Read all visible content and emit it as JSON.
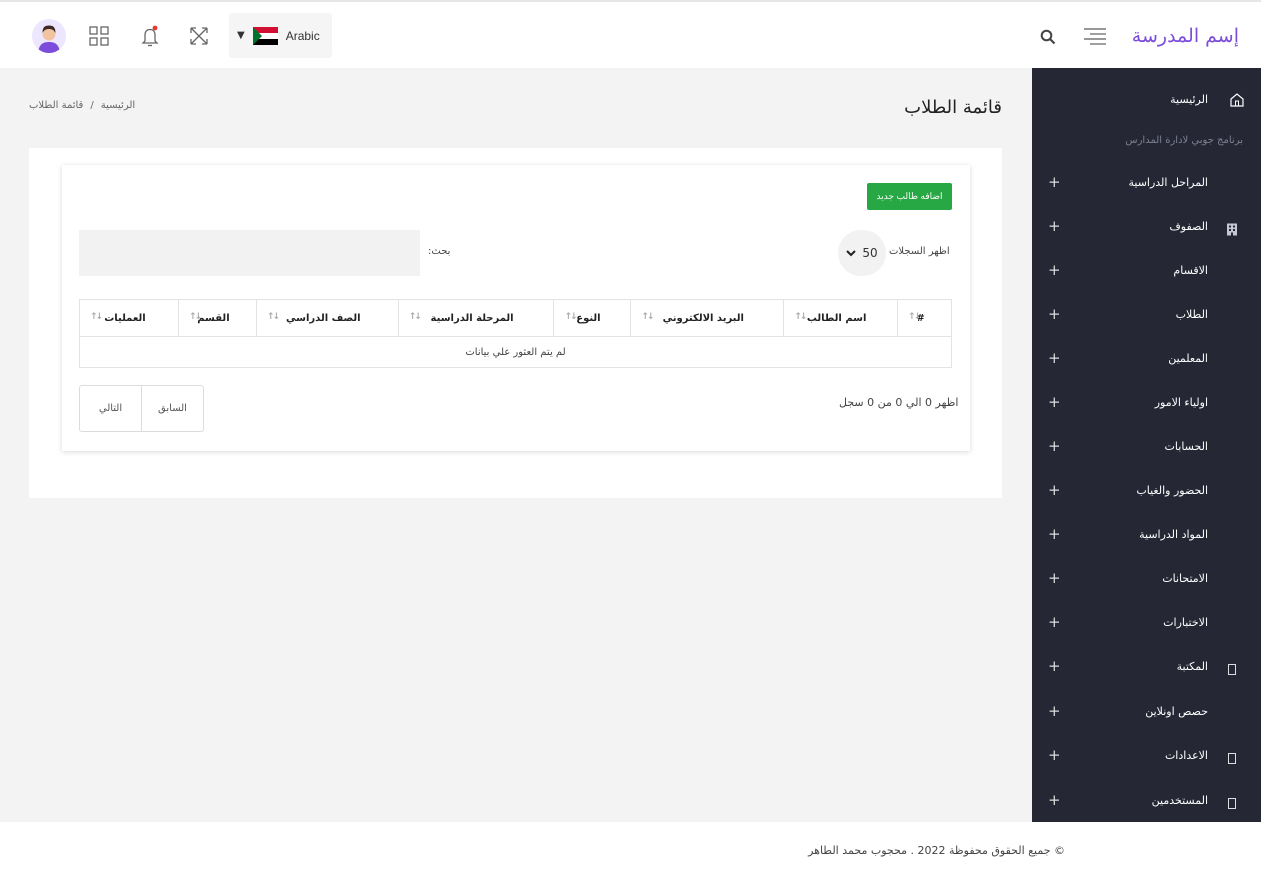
{
  "header": {
    "brand": "إسم المدرسة",
    "language": "Arabic",
    "colors": {
      "brand": "#7c4ddb",
      "sidebar_bg": "#252735",
      "add_button": "#28a745"
    }
  },
  "sidebar": {
    "home": "الرئيسية",
    "subtitle": "برنامج جوبي لادارة المدارس",
    "items": [
      {
        "label": "المراحل الدراسية",
        "icon": "none"
      },
      {
        "label": "الصفوف",
        "icon": "building-icon"
      },
      {
        "label": "الاقسام",
        "icon": "none"
      },
      {
        "label": "الطلاب",
        "icon": "none"
      },
      {
        "label": "المعلمين",
        "icon": "none"
      },
      {
        "label": "اولياء الامور",
        "icon": "none"
      },
      {
        "label": "الحسابات",
        "icon": "none"
      },
      {
        "label": "الحضور والغياب",
        "icon": "none"
      },
      {
        "label": "المواد الدراسية",
        "icon": "none"
      },
      {
        "label": "الامتحانات",
        "icon": "none"
      },
      {
        "label": "الاختبارات",
        "icon": "none"
      },
      {
        "label": "المكتبة",
        "icon": "box-icon"
      },
      {
        "label": "حصص اونلاين",
        "icon": "none"
      },
      {
        "label": "الاعدادات",
        "icon": "box-icon"
      },
      {
        "label": "المستخدمين",
        "icon": "box-icon"
      }
    ],
    "plus": "+"
  },
  "page": {
    "title": "قائمة الطلاب",
    "breadcrumb": {
      "home": "الرئيسية",
      "sep": "/",
      "current": "قائمة الطلاب"
    }
  },
  "card": {
    "add_button": "اضافه طالب جديد",
    "show_records": "اظهر السجلات",
    "page_size": "50",
    "search_label": "بحث:",
    "columns": [
      "#",
      "اسم الطالب",
      "البريد الالكتروني",
      "النوع",
      "المرحلة الدراسية",
      "الصف الدراسي",
      "القسم",
      "العمليات"
    ],
    "empty": "لم يتم العثور علي بيانات",
    "info": "اظهر 0 الي 0 من 0 سجل",
    "prev": "السابق",
    "next": "التالي"
  },
  "footer": {
    "text": "© جميع الحقوق محفوظة 2022 . محجوب محمد الطاهر"
  }
}
